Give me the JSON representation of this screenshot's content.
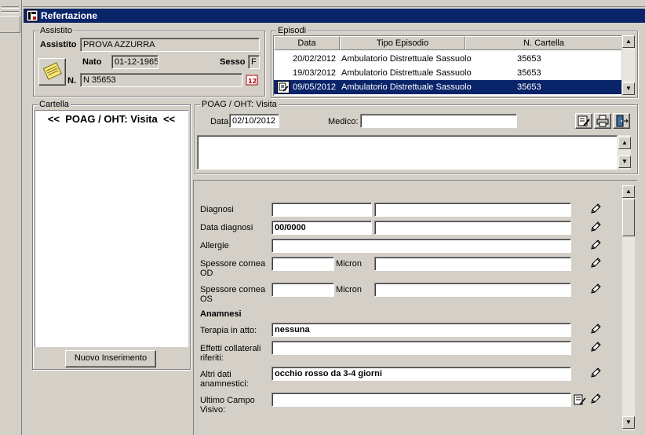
{
  "window": {
    "title": "Refertazione"
  },
  "assistito": {
    "legend": "Assistito",
    "assistito_label": "Assistito",
    "name": "PROVA AZZURRA",
    "nato_label": "Nato",
    "birth": "01-12-1965",
    "sesso_label": "Sesso",
    "sex": "F",
    "n_label": "N.",
    "number": "N 35653"
  },
  "episodi": {
    "legend": "Episodi",
    "columns": [
      "Data",
      "Tipo Episodio",
      "N. Cartella"
    ],
    "rows": [
      {
        "date": "20/02/2012",
        "type": "Ambulatorio Distrettuale Sassuolo N",
        "cartella": "35653",
        "selected": false
      },
      {
        "date": "19/03/2012",
        "type": "Ambulatorio Distrettuale Sassuolo N",
        "cartella": "35653",
        "selected": false
      },
      {
        "date": "09/05/2012",
        "type": "Ambulatorio Distrettuale Sassuolo N",
        "cartella": "35653",
        "selected": true
      }
    ]
  },
  "cartella": {
    "legend": "Cartella",
    "item": "<<  POAG / OHT: Visita  <<",
    "new_button": "Nuovo Inserimento"
  },
  "visit": {
    "legend": "POAG / OHT: Visita",
    "data_label": "Data:",
    "date": "02/10/2012",
    "medico_label": "Medico:",
    "medico": ""
  },
  "form": {
    "diagnosi_label": "Diagnosi",
    "data_diagnosi_label": "Data diagnosi",
    "data_diagnosi_value": "00/0000",
    "allergie_label": "Allergie",
    "spessore_od_label": "Spessore cornea OD",
    "spessore_os_label": "Spessore cornea OS",
    "micron_label": "Micron",
    "anamnesi_heading": "Anamnesi",
    "terapia_label": "Terapia in atto:",
    "terapia_value": "nessuna",
    "effetti_label": "Effetti collaterali riferiti:",
    "altri_label": "Altri dati anamnestici:",
    "altri_value": "occhio rosso da 3-4 giorni",
    "ultimo_label": "Ultimo Campo Visivo:"
  },
  "colors": {
    "titlebar": "#0a246a",
    "selection": "#0a246a",
    "face": "#d4d0c8"
  }
}
